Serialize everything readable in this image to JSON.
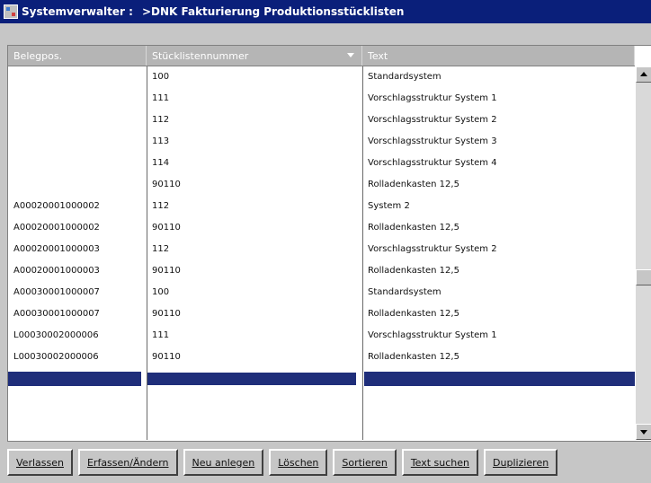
{
  "window": {
    "app_title": "Systemverwalter :",
    "module_title": ">DNK Fakturierung Produktionsstücklisten"
  },
  "table": {
    "headers": [
      "Belegpos.",
      "Stücklistennummer",
      "Text"
    ],
    "rows": [
      [
        "",
        "100",
        "Standardsystem"
      ],
      [
        "",
        "111",
        "Vorschlagsstruktur System 1"
      ],
      [
        "",
        "112",
        "Vorschlagsstruktur System 2"
      ],
      [
        "",
        "113",
        "Vorschlagsstruktur System 3"
      ],
      [
        "",
        "114",
        "Vorschlagsstruktur System 4"
      ],
      [
        "",
        "90110",
        "Rolladenkasten 12,5"
      ],
      [
        "A00020001000002",
        "112",
        "System 2"
      ],
      [
        "A00020001000002",
        "90110",
        "Rolladenkasten 12,5"
      ],
      [
        "A00020001000003",
        "112",
        "Vorschlagsstruktur System 2"
      ],
      [
        "A00020001000003",
        "90110",
        "Rolladenkasten 12,5"
      ],
      [
        "A00030001000007",
        "100",
        "Standardsystem"
      ],
      [
        "A00030001000007",
        "90110",
        "Rolladenkasten 12,5"
      ],
      [
        "L00030002000006",
        "111",
        "Vorschlagsstruktur System 1"
      ],
      [
        "L00030002000006",
        "90110",
        "Rolladenkasten 12,5"
      ]
    ],
    "selected_row": [
      "",
      "",
      ""
    ]
  },
  "buttons": [
    {
      "label": "Verlassen"
    },
    {
      "label": "Erfassen/Ändern"
    },
    {
      "label": "Neu anlegen"
    },
    {
      "label": "Löschen"
    },
    {
      "label": "Sortieren"
    },
    {
      "label": "Text suchen"
    },
    {
      "label": "Duplizieren"
    }
  ],
  "icons": {
    "app": "app-icon",
    "sort": "sort-desc-icon",
    "scroll_up": "scroll-up-icon",
    "scroll_down": "scroll-down-icon"
  },
  "colors": {
    "titlebar": "#0a1f7a",
    "selection": "#1f2e7a"
  }
}
